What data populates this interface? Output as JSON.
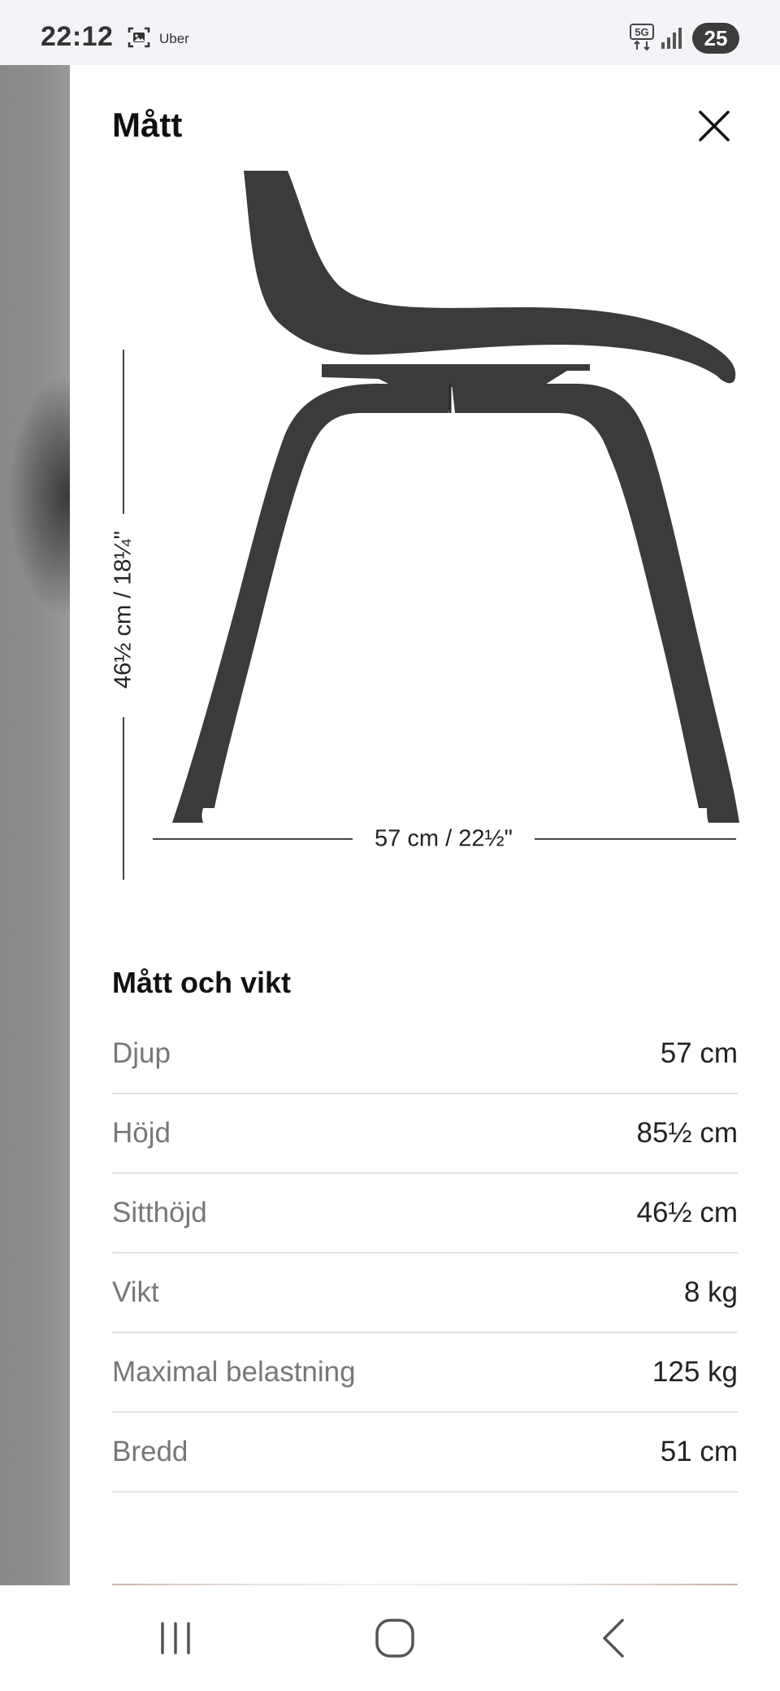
{
  "status_bar": {
    "time": "22:12",
    "app_label": "Uber",
    "network": "5G",
    "battery": "25",
    "icons": [
      "screenshot-icon",
      "5g-icon",
      "signal-icon",
      "battery-icon"
    ]
  },
  "panel": {
    "title": "Mått",
    "close_icon": "close-icon"
  },
  "diagram": {
    "height_label": "46½ cm / 18¼\"",
    "width_label": "57 cm / 22½\"",
    "chair_color": "#3b3b3b"
  },
  "specs": {
    "title": "Mått och vikt",
    "rows": [
      {
        "label": "Djup",
        "value": "57 cm"
      },
      {
        "label": "Höjd",
        "value": "85½ cm"
      },
      {
        "label": "Sitthöjd",
        "value": "46½ cm"
      },
      {
        "label": "Vikt",
        "value": "8 kg"
      },
      {
        "label": "Maximal belastning",
        "value": "125 kg"
      },
      {
        "label": "Bredd",
        "value": "51 cm"
      }
    ]
  },
  "nav_bar": {
    "buttons": [
      "recent-apps-icon",
      "home-icon",
      "back-icon"
    ]
  }
}
